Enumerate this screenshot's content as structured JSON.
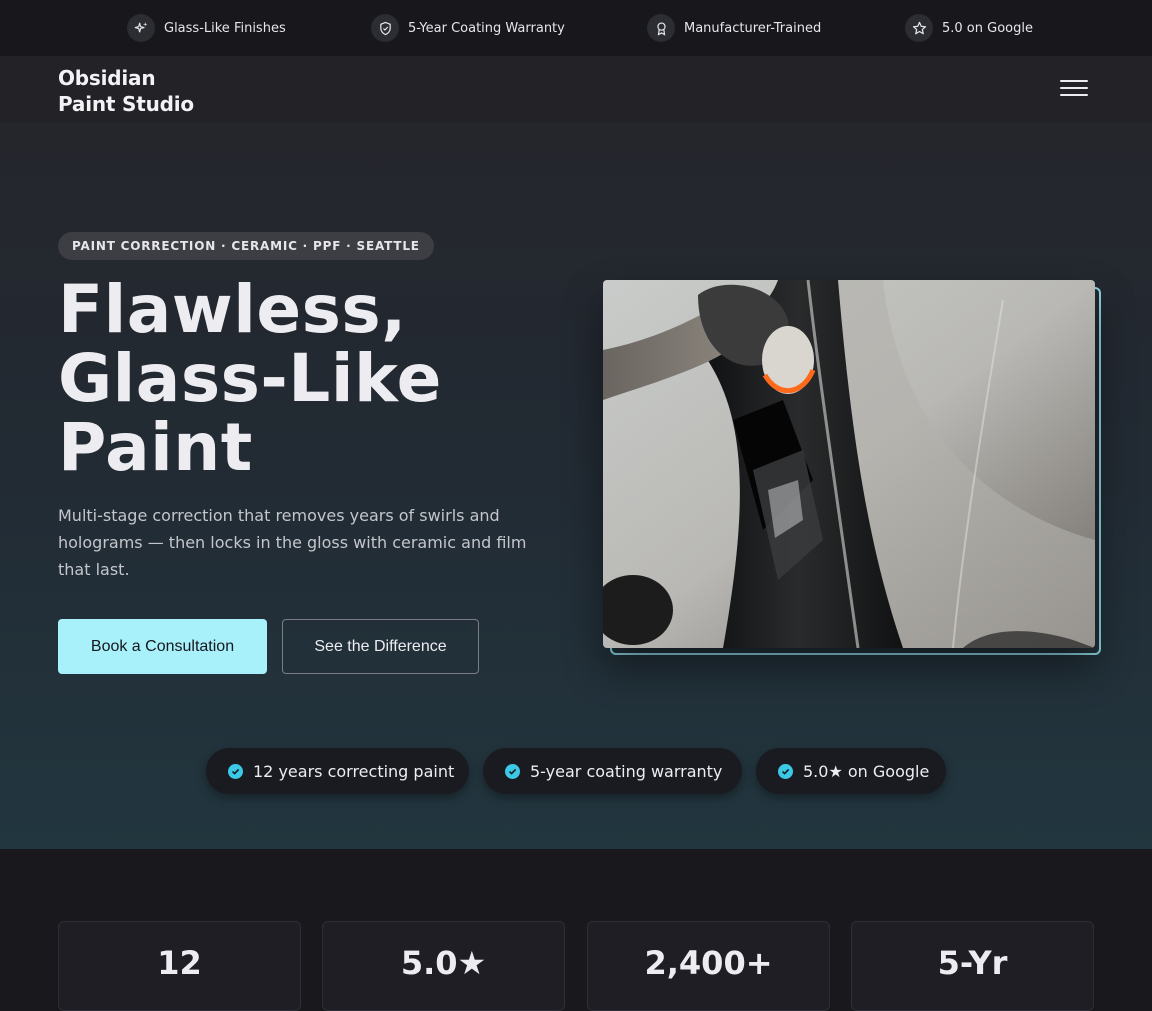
{
  "topbar": {
    "items": [
      {
        "label": "Glass-Like Finishes",
        "icon": "sparkle-icon"
      },
      {
        "label": "5-Year Coating Warranty",
        "icon": "shield-icon"
      },
      {
        "label": "Manufacturer-Trained",
        "icon": "award-icon"
      },
      {
        "label": "5.0 on Google",
        "icon": "star-icon"
      }
    ]
  },
  "nav": {
    "brand": "Obsidian Paint Studio",
    "menu_icon": "hamburger-menu-icon"
  },
  "hero": {
    "eyebrow": "PAINT CORRECTION · CERAMIC · PPF · SEATTLE",
    "headline": "Flawless, Glass-Like Paint",
    "subtext": "Multi-stage correction that removes years of swirls and holograms — then locks in the gloss with ceramic and film that last.",
    "primary_cta": "Book a Consultation",
    "secondary_cta": "See the Difference"
  },
  "badges": [
    "12 years correcting paint",
    "5-year coating warranty",
    "5.0★ on Google"
  ],
  "stats": [
    {
      "value": "12"
    },
    {
      "value": "5.0★"
    },
    {
      "value": "2,400+"
    },
    {
      "value": "5-Yr"
    }
  ],
  "colors": {
    "accent": "#a8f0fa",
    "check": "#3bc9e6",
    "frame": "#8fd8e6"
  }
}
